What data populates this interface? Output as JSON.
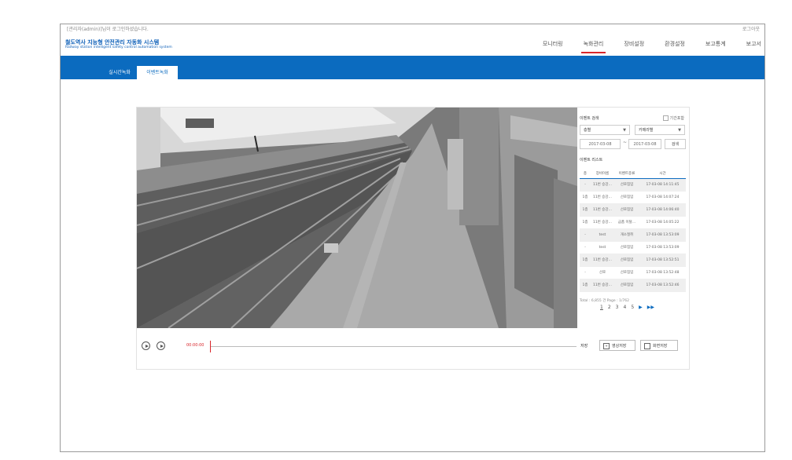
{
  "topbar": {
    "login_status": "[관리자(admin)]님이 로그인하셨습니다.",
    "logout": "로그아웃"
  },
  "header": {
    "title": "철도역사 지능형 안전관리 자동화 시스템",
    "subtitle": "Railway station intelligent safety control automation system"
  },
  "nav": [
    "모니터링",
    "녹화관리",
    "장비설정",
    "환경설정",
    "보고통계",
    "보고서"
  ],
  "tabs": [
    "실시간녹화",
    "이벤트녹화"
  ],
  "event_search": {
    "title": "이벤트 검색",
    "period_checkbox": "기간포함",
    "floor_select": "층별",
    "camera_select": "카메라별",
    "date_from": "2017-03-08",
    "date_to": "2017-03-08",
    "separator": "~",
    "search_button": "검색"
  },
  "event_list": {
    "title": "이벤트 리스트",
    "columns": [
      "층",
      "장비이름",
      "이벤트종류",
      "시간"
    ],
    "rows": [
      [
        "-",
        "11번 승강…",
        "선로침입",
        "17-03-08 14:11:45"
      ],
      [
        "1층",
        "11번 승강…",
        "선로침입",
        "17-03-08 14:07:24"
      ],
      [
        "1층",
        "11번 승강…",
        "선로침입",
        "17-03-08 14:06:40"
      ],
      [
        "1층",
        "11번 승강…",
        "금품 이탈…",
        "17-03-08 14:05:22"
      ],
      [
        "-",
        "test",
        "개소절취",
        "17-03-08 13:53:09"
      ],
      [
        "-",
        "test",
        "선로침입",
        "17-03-08 13:53:09"
      ],
      [
        "1층",
        "11번 승강…",
        "선로침입",
        "17-03-08 13:52:51"
      ],
      [
        "-",
        "선로",
        "선로침입",
        "17-03-08 13:52:48"
      ],
      [
        "1층",
        "11번 승강…",
        "선로침입",
        "17-03-08 13:52:46"
      ]
    ],
    "total": "Total : 6,855 건 Page : 1/762",
    "pages": [
      "1",
      "2",
      "3",
      "4",
      "5"
    ],
    "next": "▶",
    "last": "▶▶"
  },
  "player": {
    "time": "00:00:00",
    "save_label": "저장",
    "video_save": "영상저장",
    "screen_save": "화면저장"
  },
  "colors": {
    "brand_blue": "#0b6bbf",
    "accent_red": "#d9262b"
  }
}
